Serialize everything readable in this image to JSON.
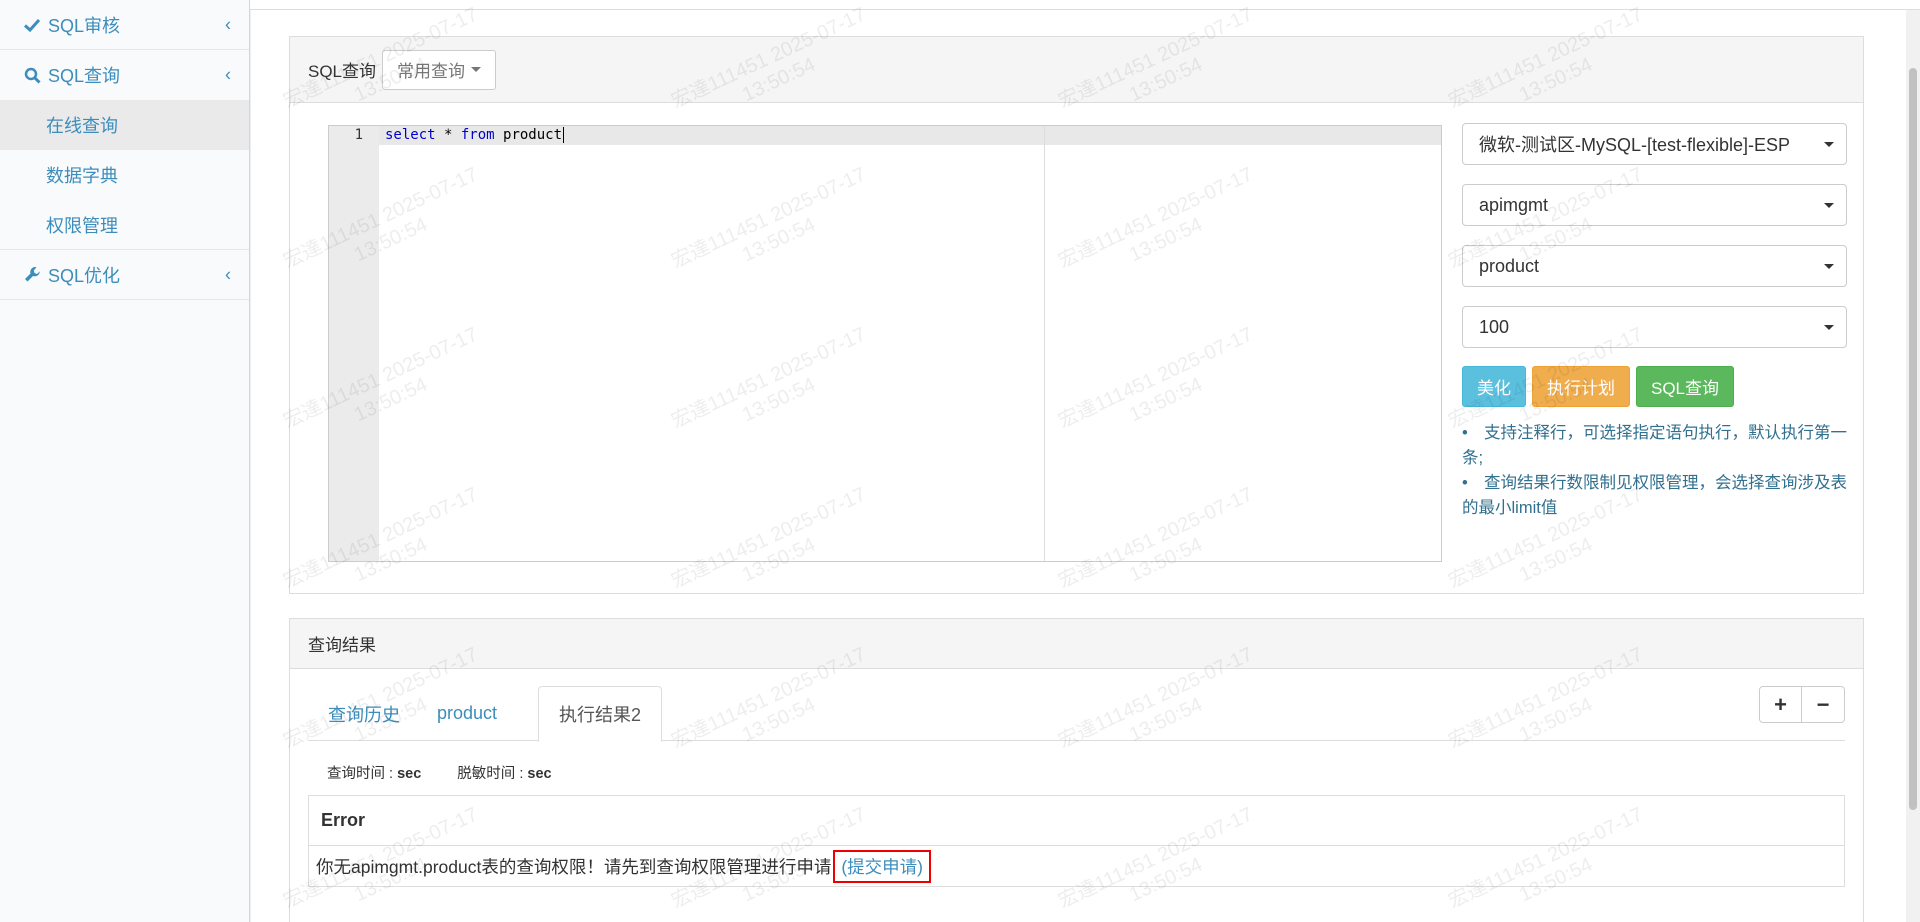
{
  "sidebar": {
    "items": [
      {
        "label": "SQL审核"
      },
      {
        "label": "SQL查询"
      },
      {
        "label": "SQL优化"
      }
    ],
    "sub_items": [
      {
        "label": "在线查询"
      },
      {
        "label": "数据字典"
      },
      {
        "label": "权限管理"
      }
    ]
  },
  "query_panel": {
    "title": "SQL查询",
    "common_query_label": "常用查询",
    "editor": {
      "line_number": "1",
      "kw_select": "select",
      "star": " * ",
      "kw_from": "from",
      "table": " product"
    },
    "selects": {
      "instance": "微软-测试区-MySQL-[test-flexible]-ESP",
      "database": "apimgmt",
      "table": "product",
      "limit": "100"
    },
    "buttons": {
      "beautify": "美化",
      "explain": "执行计划",
      "query": "SQL查询"
    },
    "notes": [
      "支持注释行，可选择指定语句执行，默认执行第一条;",
      "查询结果行数限制见权限管理，会选择查询涉及表的最小limit值"
    ]
  },
  "result_panel": {
    "title": "查询结果",
    "tabs": [
      "查询历史",
      "product",
      "执行结果2"
    ],
    "plus": "+",
    "minus": "−",
    "query_time_label": "查询时间 : ",
    "query_time_value": "sec",
    "mask_time_label": "脱敏时间 : ",
    "mask_time_value": "sec",
    "error_title": "Error",
    "error_message": "你无apimgmt.product表的查询权限！请先到查询权限管理进行申请",
    "error_link": "(提交申请)"
  },
  "watermark": {
    "line1": "宏達111451 2025-07-17",
    "line2": "13:50:54"
  }
}
